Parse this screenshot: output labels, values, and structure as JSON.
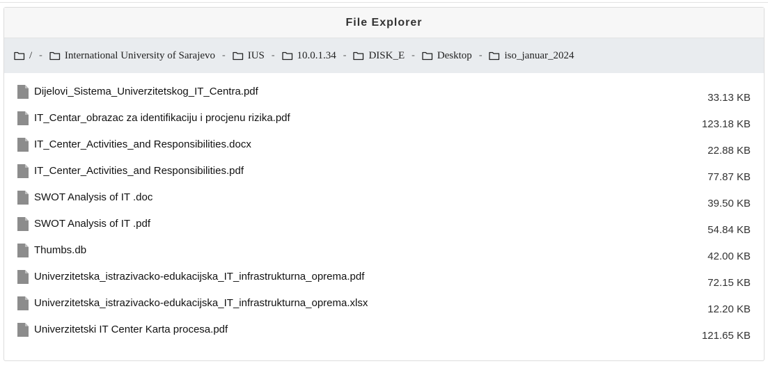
{
  "window": {
    "title": "File Explorer"
  },
  "breadcrumb": [
    {
      "label": "/"
    },
    {
      "label": "International University of Sarajevo"
    },
    {
      "label": "IUS"
    },
    {
      "label": "10.0.1.34"
    },
    {
      "label": "DISK_E"
    },
    {
      "label": "Desktop"
    },
    {
      "label": "iso_januar_2024"
    }
  ],
  "breadcrumb_separator": "-",
  "files": [
    {
      "name": "Dijelovi_Sistema_Univerzitetskog_IT_Centra.pdf",
      "size": "33.13 KB"
    },
    {
      "name": "IT_Centar_obrazac za identifikaciju i procjenu rizika.pdf",
      "size": "123.18 KB"
    },
    {
      "name": "IT_Center_Activities_and Responsibilities.docx",
      "size": "22.88 KB"
    },
    {
      "name": "IT_Center_Activities_and Responsibilities.pdf",
      "size": "77.87 KB"
    },
    {
      "name": "SWOT Analysis of IT .doc",
      "size": "39.50 KB"
    },
    {
      "name": "SWOT Analysis of IT .pdf",
      "size": "54.84 KB"
    },
    {
      "name": "Thumbs.db",
      "size": "42.00 KB"
    },
    {
      "name": "Univerzitetska_istrazivacko-edukacijska_IT_infrastrukturna_oprema.pdf",
      "size": "72.15 KB"
    },
    {
      "name": "Univerzitetska_istrazivacko-edukacijska_IT_infrastrukturna_oprema.xlsx",
      "size": "12.20 KB"
    },
    {
      "name": "Univerzitetski IT Center Karta procesa.pdf",
      "size": "121.65 KB"
    }
  ],
  "icons": {
    "folder": "folder-outline-icon",
    "file": "file-icon"
  },
  "colors": {
    "header_bg": "#f7f7f7",
    "breadcrumb_bg": "#e9ecef",
    "file_icon": "#8c8c8c"
  }
}
